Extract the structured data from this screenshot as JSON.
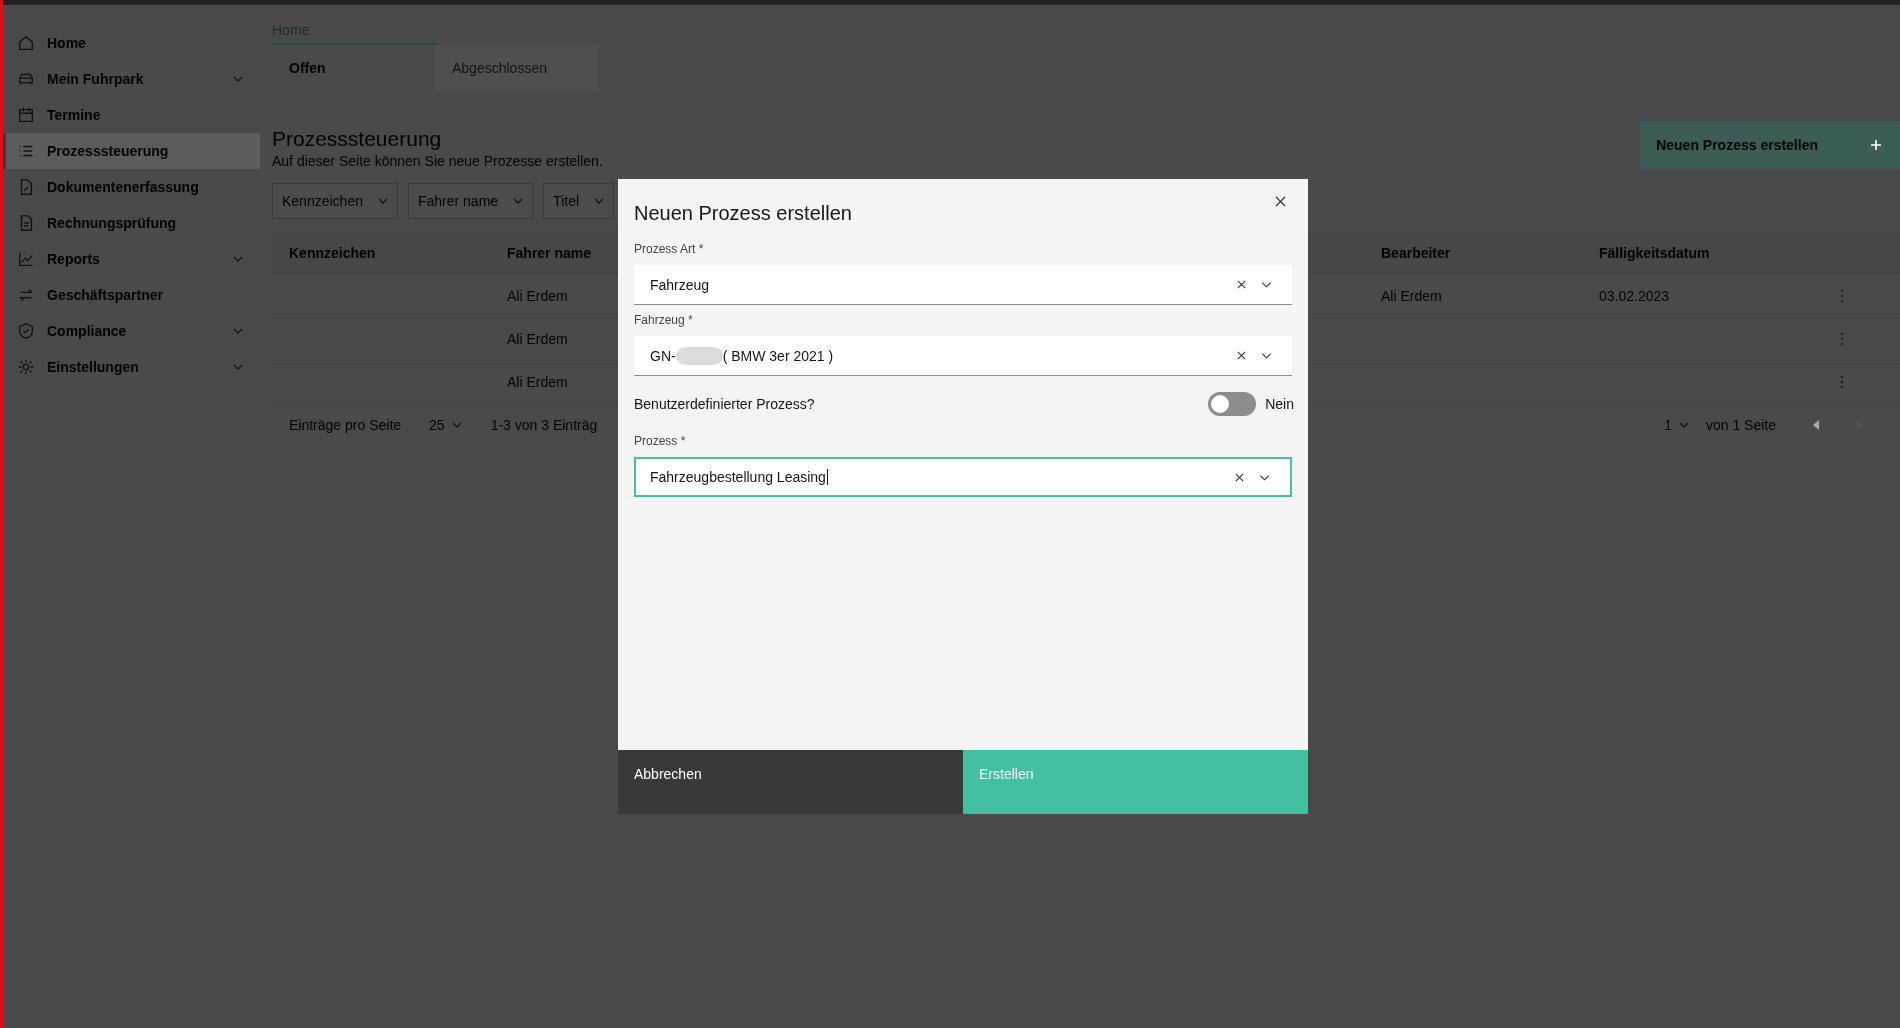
{
  "sidebar": {
    "items": [
      {
        "label": "Home",
        "selected": false,
        "expandable": false
      },
      {
        "label": "Mein Fuhrpark",
        "selected": false,
        "expandable": true
      },
      {
        "label": "Termine",
        "selected": false,
        "expandable": false
      },
      {
        "label": "Prozesssteuerung",
        "selected": true,
        "expandable": false
      },
      {
        "label": "Dokumentenerfassung",
        "selected": false,
        "expandable": false
      },
      {
        "label": "Rechnungsprüfung",
        "selected": false,
        "expandable": false
      },
      {
        "label": "Reports",
        "selected": false,
        "expandable": true
      },
      {
        "label": "Geschäftspartner",
        "selected": false,
        "expandable": false
      },
      {
        "label": "Compliance",
        "selected": false,
        "expandable": true
      },
      {
        "label": "Einstellungen",
        "selected": false,
        "expandable": true
      }
    ]
  },
  "breadcrumb": "Home",
  "tabs": [
    {
      "label": "Offen",
      "selected": true
    },
    {
      "label": "Abgeschlossen",
      "selected": false
    }
  ],
  "page": {
    "title": "Prozesssteuerung",
    "subtitle": "Auf dieser Seite können Sie neue Prozesse erstellen.",
    "create_button": "Neuen Prozess erstellen"
  },
  "filters": [
    "Kennzeichen",
    "Fahrer name",
    "Titel"
  ],
  "table": {
    "columns": [
      "Kennzeichen",
      "Fahrer name",
      "Bearbeiter",
      "Fälligkeitsdatum"
    ],
    "rows": [
      {
        "fahrer_name": "Ali Erdem",
        "bearbeiter": "Ali Erdem",
        "faelligkeitsdatum": "03.02.2023"
      },
      {
        "fahrer_name": "Ali Erdem"
      },
      {
        "fahrer_name": "Ali Erdem"
      }
    ]
  },
  "pagination": {
    "per_page_label": "Einträge pro Seite",
    "per_page": "25",
    "range": "1-3 von 3 Einträg",
    "page": "1",
    "page_total": "von 1 Seite"
  },
  "dialog": {
    "title": "Neuen Prozess erstellen",
    "fields": [
      {
        "kind": "select",
        "label": "Prozess Art *",
        "value": "Fahrzeug",
        "focused": false
      },
      {
        "kind": "select",
        "label": "Fahrzeug *",
        "value": "GN-",
        "redacted": true,
        "value_after": "( BMW 3er 2021 )",
        "focused": false
      },
      {
        "kind": "toggle",
        "label": "Benutzerdefinierter Prozess?",
        "on": false,
        "state_label": "Nein"
      },
      {
        "kind": "select",
        "label": "Prozess *",
        "value": "Fahrzeugbestellung Leasing",
        "focused": true
      }
    ],
    "buttons": [
      {
        "kind": "secondary",
        "label": "Abbrechen"
      },
      {
        "kind": "primary",
        "label": "Erstellen"
      }
    ]
  }
}
